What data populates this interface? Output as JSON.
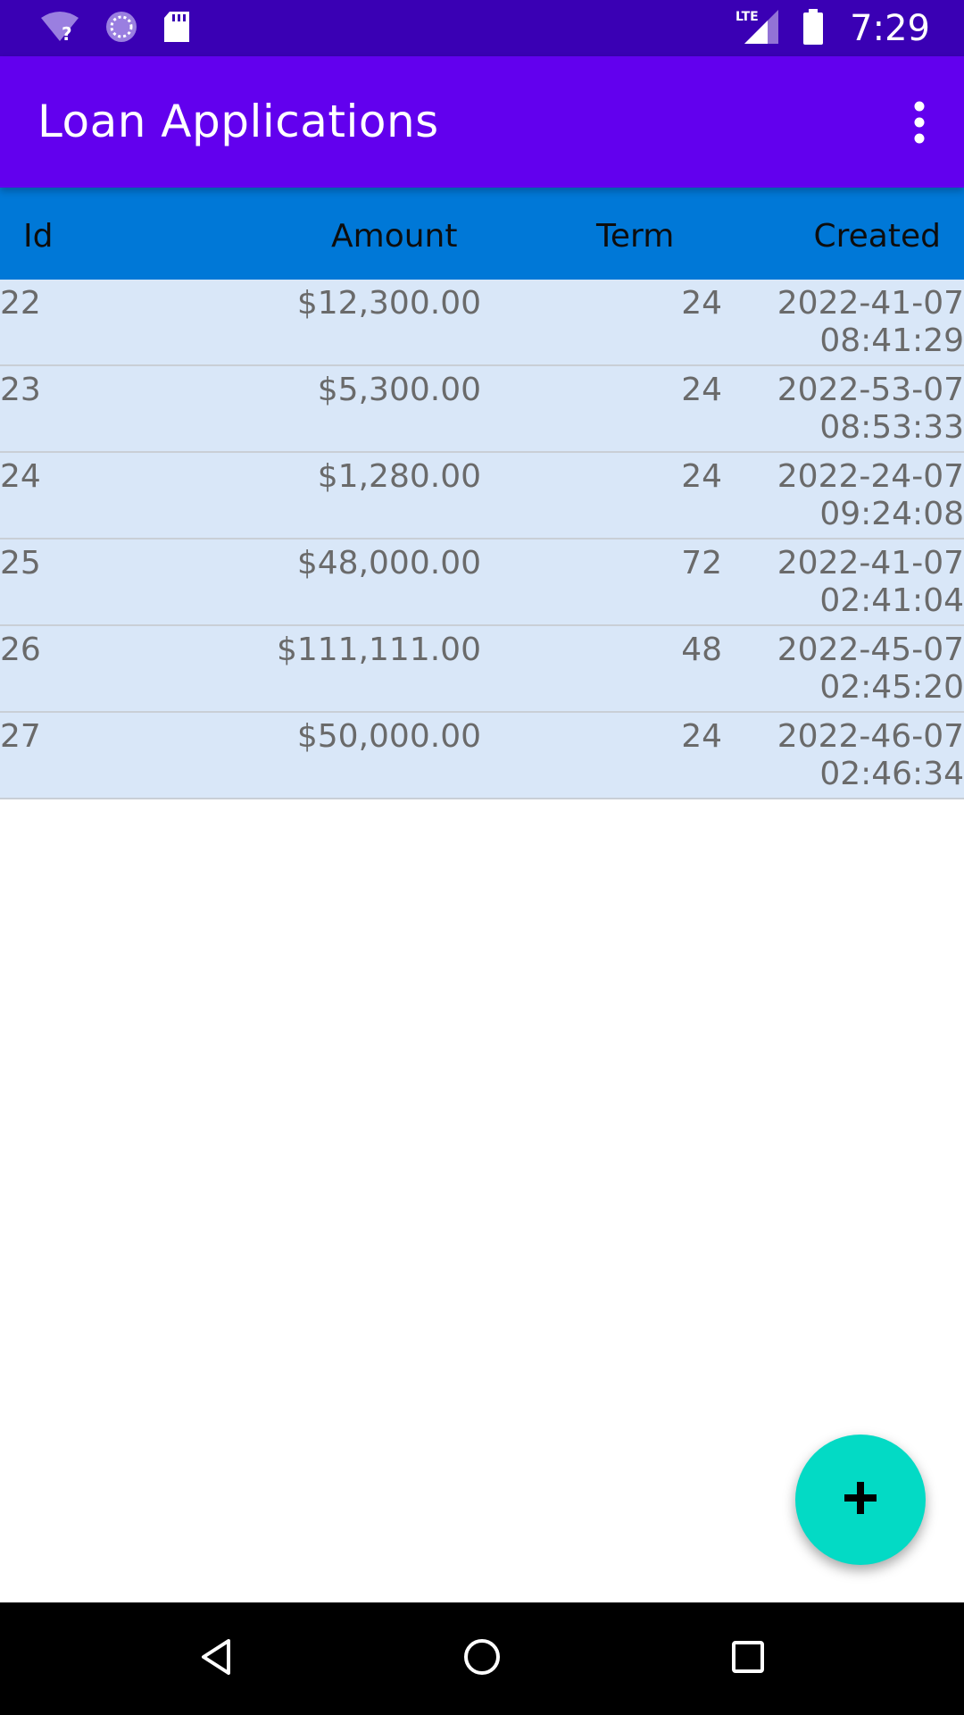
{
  "status_bar": {
    "time": "7:29",
    "network_label": "LTE",
    "icons": [
      "wifi-unknown-icon",
      "sync-icon",
      "sd-card-icon",
      "signal-icon",
      "battery-icon"
    ]
  },
  "app_bar": {
    "title": "Loan Applications",
    "overflow_icon": "more-vertical-icon"
  },
  "table": {
    "columns": [
      "Id",
      "Amount",
      "Term",
      "Created"
    ],
    "rows": [
      {
        "id": "22",
        "amount": "$12,300.00",
        "term": "24",
        "created_date": "2022-41-07",
        "created_time": "08:41:29"
      },
      {
        "id": "23",
        "amount": "$5,300.00",
        "term": "24",
        "created_date": "2022-53-07",
        "created_time": "08:53:33"
      },
      {
        "id": "24",
        "amount": "$1,280.00",
        "term": "24",
        "created_date": "2022-24-07",
        "created_time": "09:24:08"
      },
      {
        "id": "25",
        "amount": "$48,000.00",
        "term": "72",
        "created_date": "2022-41-07",
        "created_time": "02:41:04"
      },
      {
        "id": "26",
        "amount": "$111,111.00",
        "term": "48",
        "created_date": "2022-45-07",
        "created_time": "02:45:20"
      },
      {
        "id": "27",
        "amount": "$50,000.00",
        "term": "24",
        "created_date": "2022-46-07",
        "created_time": "02:46:34"
      }
    ]
  },
  "fab": {
    "icon": "add-icon"
  },
  "nav_bar": {
    "icons": [
      "back-icon",
      "home-icon",
      "recents-icon"
    ]
  },
  "colors": {
    "status_bar": "#3a00b4",
    "app_bar": "#6200ee",
    "table_header": "#0078d7",
    "row_background": "#d9e7f8",
    "fab": "#03dac5"
  }
}
